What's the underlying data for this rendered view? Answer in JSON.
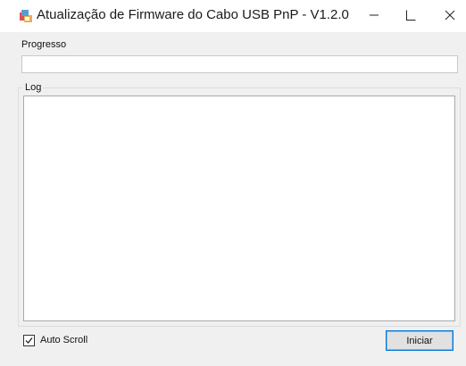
{
  "window": {
    "title": "Atualização de Firmware do Cabo USB PnP - V1.2.0",
    "controls": {
      "minimize": "minimize-icon",
      "maximize": "maximize-icon",
      "close": "close-icon"
    }
  },
  "progress": {
    "label": "Progresso",
    "value": 0
  },
  "log": {
    "label": "Log",
    "content": ""
  },
  "options": {
    "autoscroll_label": "Auto Scroll",
    "autoscroll_checked": true
  },
  "actions": {
    "start_label": "Iniciar"
  },
  "colors": {
    "client_bg": "#f0f0f0",
    "button_focus": "#0078d7",
    "progress_fill": "#06b025"
  }
}
